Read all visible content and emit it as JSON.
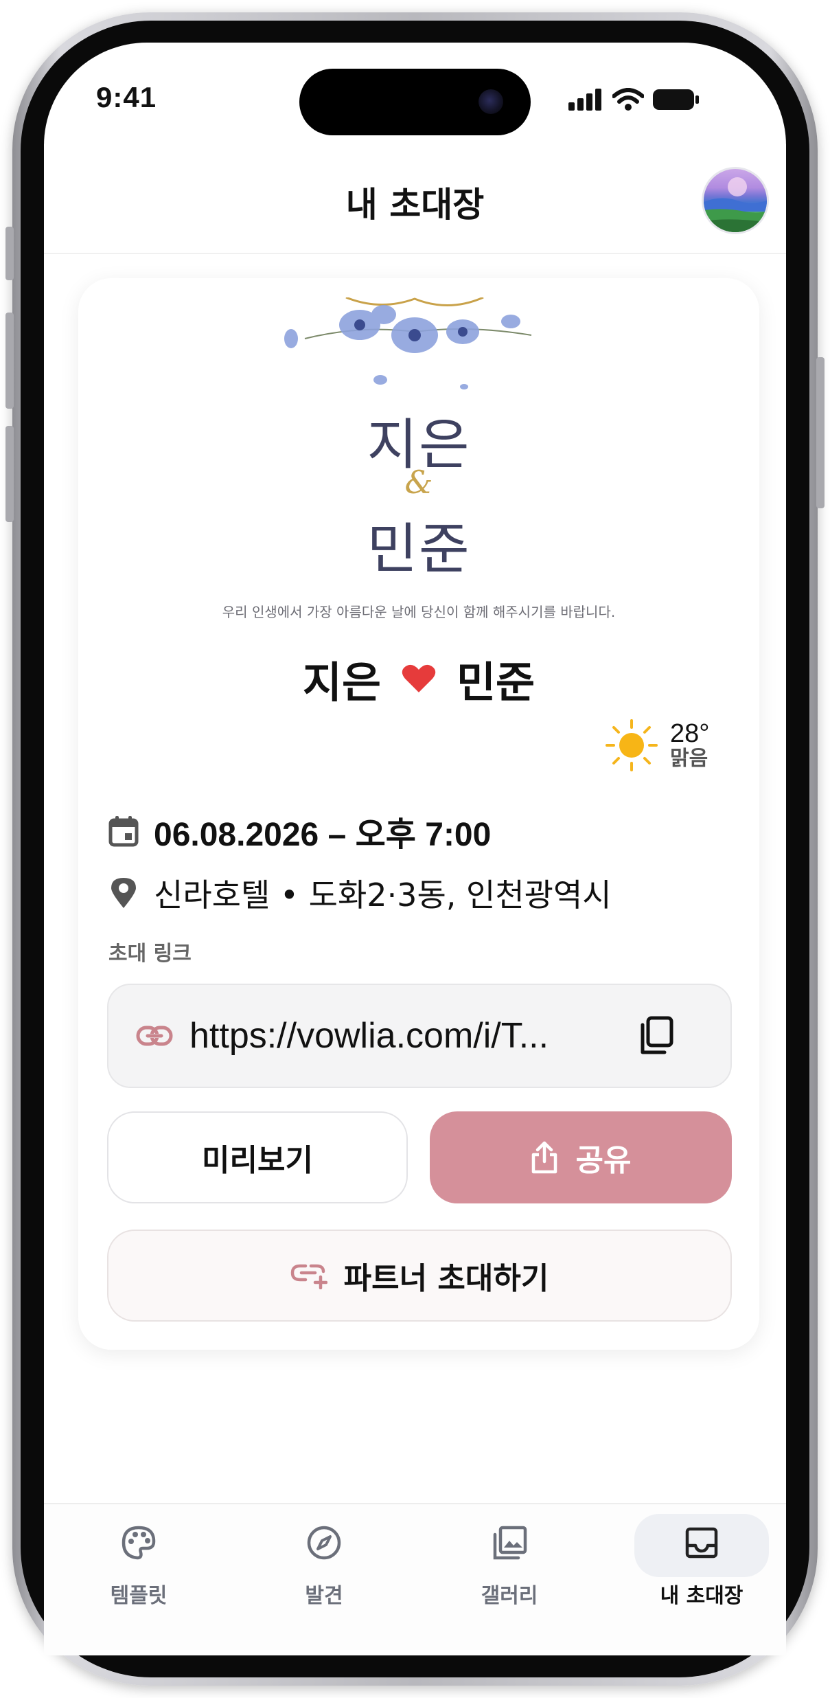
{
  "status_bar": {
    "time": "9:41"
  },
  "header": {
    "title": "내 초대장"
  },
  "invitation": {
    "name_top": "지은",
    "ampersand": "&",
    "name_bottom": "민준",
    "greeting": "우리 인생에서 가장 아름다운 날에 당신이 함께 해주시기를 바랍니다.",
    "bride": "지은",
    "groom": "민준",
    "heart_color": "#e63b3b"
  },
  "weather": {
    "temperature": "28°",
    "condition": "맑음",
    "icon": "sun-icon"
  },
  "details": {
    "datetime": "06.08.2026 – 오후 7:00",
    "location": "신라호텔 • 도화2·3동, 인천광역시"
  },
  "link": {
    "label": "초대 링크",
    "url": "https://vowlia.com/i/T..."
  },
  "actions": {
    "preview": "미리보기",
    "share": "공유",
    "invite_partner": "파트너 초대하기"
  },
  "colors": {
    "accent": "#d5909a",
    "accent_icon": "#c9848c",
    "text": "#111111"
  },
  "tabs": [
    {
      "label": "템플릿",
      "icon": "palette-icon",
      "active": false
    },
    {
      "label": "발견",
      "icon": "compass-icon",
      "active": false
    },
    {
      "label": "갤러리",
      "icon": "gallery-icon",
      "active": false
    },
    {
      "label": "내 초대장",
      "icon": "inbox-icon",
      "active": true
    }
  ]
}
